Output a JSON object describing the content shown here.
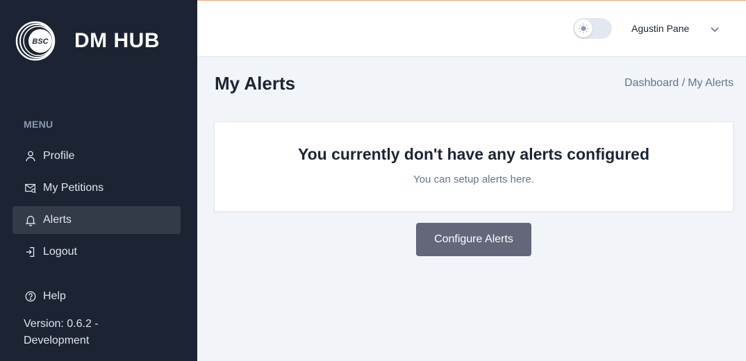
{
  "sidebar": {
    "logo_text": "BSC",
    "brand": "DM HUB",
    "menu_heading": "MENU",
    "items": [
      {
        "label": "Profile",
        "icon": "user-icon"
      },
      {
        "label": "My Petitions",
        "icon": "mail-icon"
      },
      {
        "label": "Alerts",
        "icon": "bell-icon",
        "active": true
      },
      {
        "label": "Logout",
        "icon": "logout-icon"
      },
      {
        "label": "Help",
        "icon": "help-circle-icon"
      }
    ],
    "version": "Version: 0.6.2 - Development"
  },
  "header": {
    "theme_toggle": "light",
    "user_name": "Agustin Pane"
  },
  "main": {
    "title": "My Alerts",
    "breadcrumb": [
      "Dashboard /",
      "My Alerts"
    ],
    "empty_title": "You currently don't have any alerts configured",
    "empty_subtitle": "You can setup alerts here.",
    "configure_button": "Configure Alerts"
  },
  "colors": {
    "sidebar_bg": "#1c2434",
    "page_bg": "#f1f5f9",
    "button_bg": "#64667a",
    "active_item_bg": "#333a48"
  }
}
